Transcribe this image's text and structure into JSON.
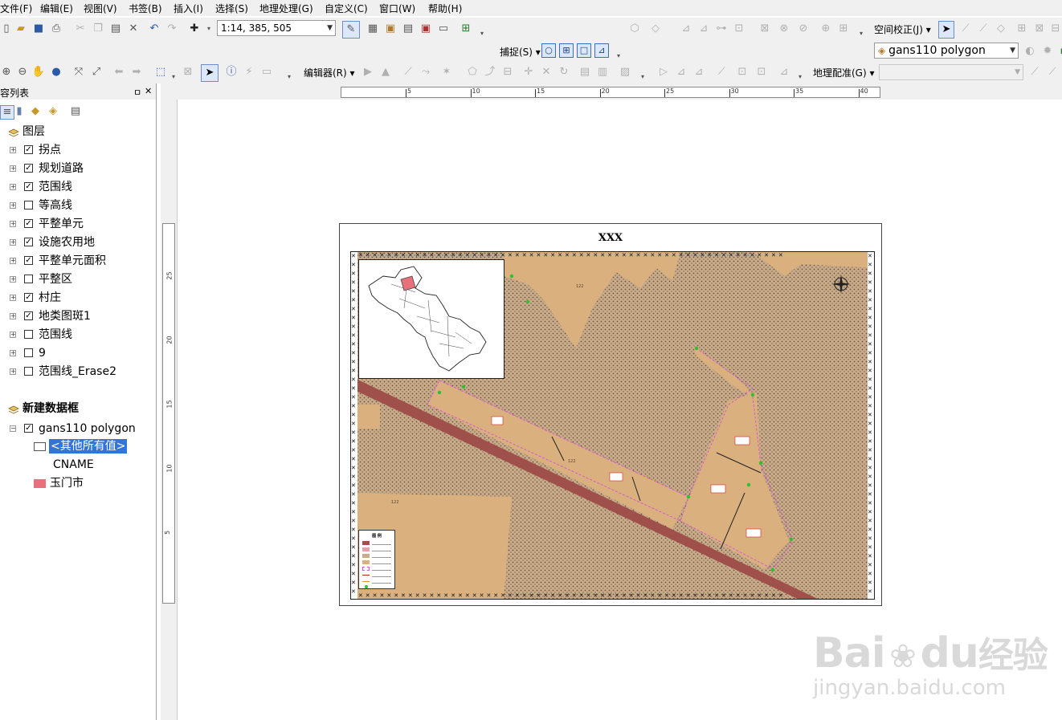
{
  "menu": [
    "文件(F)",
    "编辑(E)",
    "视图(V)",
    "书签(B)",
    "插入(I)",
    "选择(S)",
    "地理处理(G)",
    "自定义(C)",
    "窗口(W)",
    "帮助(H)"
  ],
  "toolbar": {
    "scale_value": "1:14, 385, 505",
    "spatial_adjust": "空间校正(J)",
    "snapping": "捕捉(S)",
    "layer_combo": "gans110 polygon",
    "editor": "编辑器(R)",
    "georef": "地理配准(G)"
  },
  "toc": {
    "title": "容列表",
    "pin": "ㅁ",
    "close": "✕",
    "layers_group": "图层",
    "layers": [
      {
        "name": "拐点",
        "checked": true
      },
      {
        "name": "规划道路",
        "checked": true
      },
      {
        "name": "范围线",
        "checked": true
      },
      {
        "name": "等高线",
        "checked": false
      },
      {
        "name": "平整单元",
        "checked": true
      },
      {
        "name": "设施农用地",
        "checked": true
      },
      {
        "name": "平整单元面积",
        "checked": true
      },
      {
        "name": "平整区",
        "checked": false
      },
      {
        "name": "村庄",
        "checked": true
      },
      {
        "name": "地类图斑1",
        "checked": true
      },
      {
        "name": "范围线",
        "checked": false
      },
      {
        "name": "9",
        "checked": false
      },
      {
        "name": "范围线_Erase2",
        "checked": false
      }
    ],
    "frame_group": "新建数据框",
    "frame_layer": "gans110 polygon",
    "other_values": "<其他所有值>",
    "field_name": "CNAME",
    "class_value": "玉门市",
    "class_color": "#e8707c"
  },
  "ruler": {
    "h_ticks": [
      "5",
      "10",
      "15",
      "20",
      "25",
      "30",
      "35",
      "40"
    ],
    "v_ticks": [
      "25",
      "20",
      "15",
      "10",
      "5"
    ]
  },
  "map": {
    "title": "XXX",
    "label_122_a": "122",
    "label_122_b": "122",
    "label_122_c": "122",
    "legend_title": "图 例",
    "colors": {
      "land_tan": "#d9b07e",
      "road": "#a0504a",
      "dots": "#6b5040",
      "boundary": "#d45ad0"
    }
  },
  "watermark": {
    "brand": "Bai",
    "brand2": "du",
    "cn": "经验",
    "url": "jingyan.baidu.com"
  }
}
